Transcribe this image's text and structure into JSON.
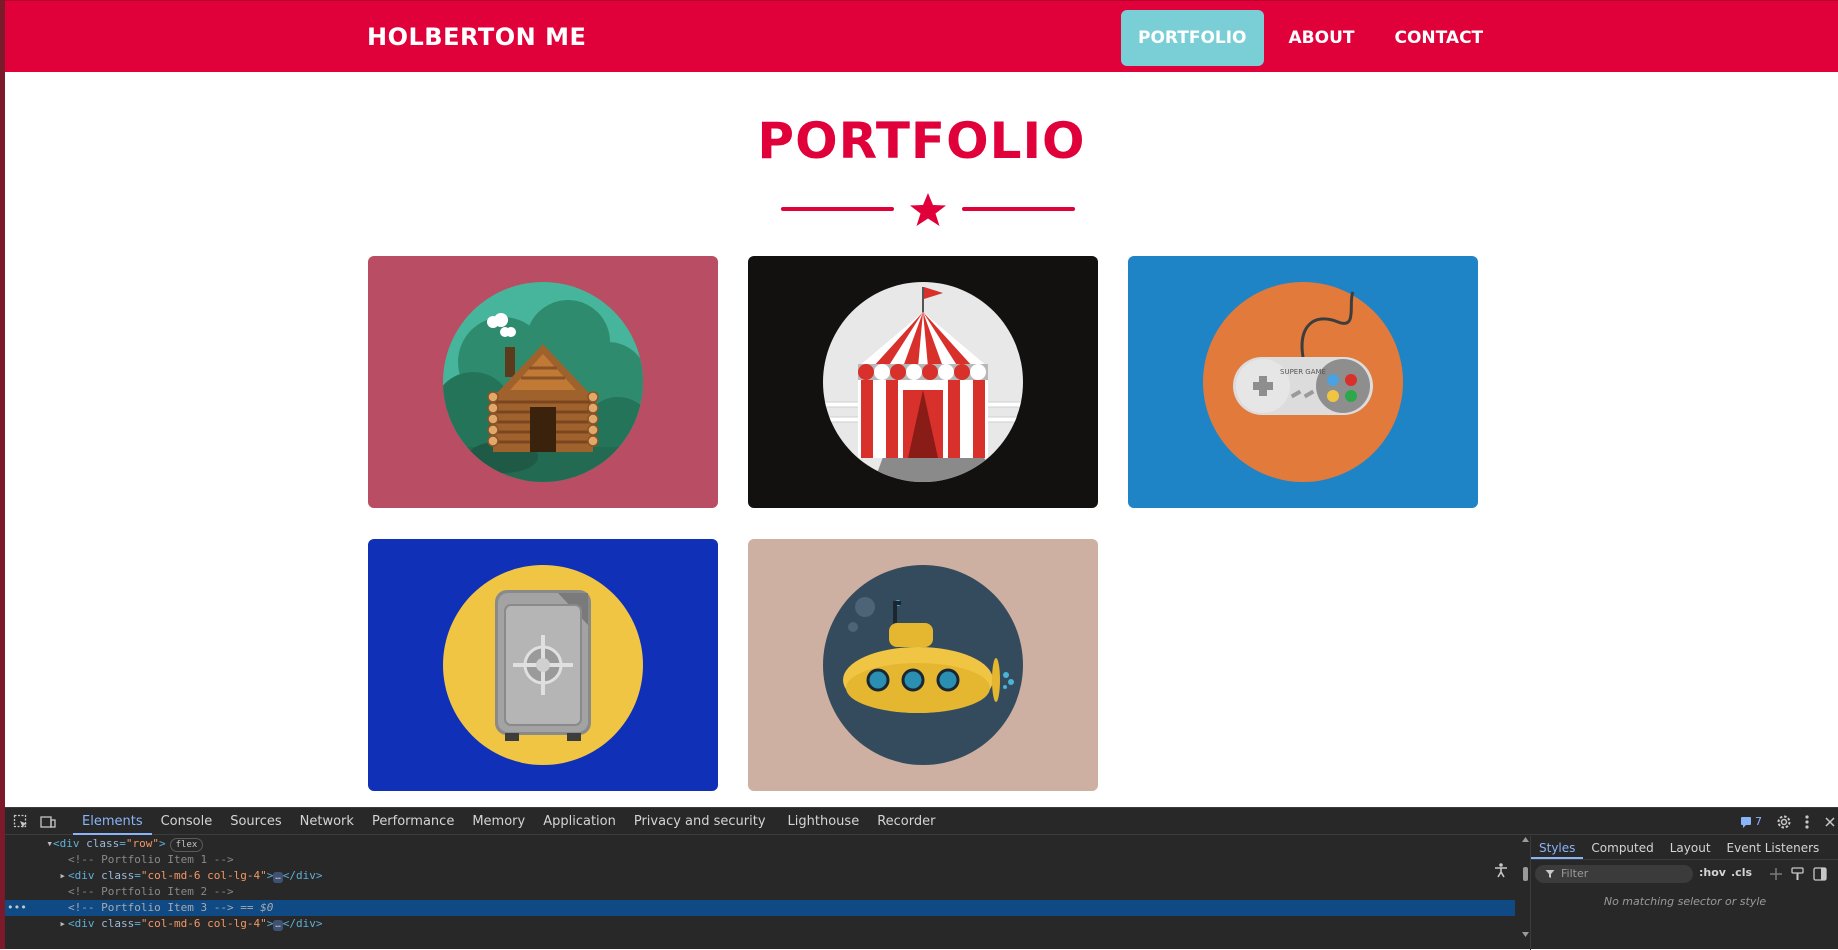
{
  "navbar": {
    "brand": "HOLBERTON ME",
    "items": [
      {
        "label": "PORTFOLIO",
        "active": true
      },
      {
        "label": "ABOUT",
        "active": false
      },
      {
        "label": "CONTACT",
        "active": false
      }
    ]
  },
  "portfolio": {
    "title": "PORTFOLIO",
    "items": [
      {
        "name": "cabin",
        "icon": "log-cabin-icon",
        "bg": "#b94d63",
        "circle": "#46b59b"
      },
      {
        "name": "circus",
        "icon": "circus-tent-icon",
        "bg": "#131010",
        "circle": "#e8e8e8"
      },
      {
        "name": "game",
        "icon": "game-controller-icon",
        "bg": "#1e84c6",
        "circle": "#e27a3c"
      },
      {
        "name": "safe",
        "icon": "safe-icon",
        "bg": "#1031b7",
        "circle": "#f0c544"
      },
      {
        "name": "submarine",
        "icon": "submarine-icon",
        "bg": "#cdb0a2",
        "circle": "#344b5e"
      }
    ]
  },
  "colors": {
    "accent": "#e0003a",
    "active_nav": "#7acfd6"
  },
  "devtools": {
    "tabs": [
      "Elements",
      "Console",
      "Sources",
      "Network",
      "Performance",
      "Memory",
      "Application",
      "Privacy and security",
      "Lighthouse",
      "Recorder"
    ],
    "active_tab": "Elements",
    "issues_count": "7",
    "dom_lines": [
      {
        "tag_open": "<div ",
        "attr": "class",
        "value": "\"row\"",
        "tag_close": ">",
        "pill": "flex"
      },
      {
        "comment": "<!-- Portfolio Item 1 -->"
      },
      {
        "tag_open": "<div ",
        "attr": "class",
        "value": "\"col-md-6 col-lg-4\"",
        "tag_close": ">",
        "ell": "…",
        "end": "</div>"
      },
      {
        "comment": "<!-- Portfolio Item 2 -->"
      },
      {
        "comment": "<!-- Portfolio Item 3 -->",
        "suffix": " == $0"
      },
      {
        "tag_open": "<div ",
        "attr": "class",
        "value": "\"col-md-6 col-lg-4\"",
        "tag_close": ">",
        "ell": "…",
        "end": "</div>"
      }
    ],
    "side_tabs": [
      "Styles",
      "Computed",
      "Layout",
      "Event Listeners"
    ],
    "filter_placeholder": "Filter",
    "hov_label": ":hov",
    "cls_label": ".cls",
    "no_match": "No matching selector or style",
    "row_dots": "•••"
  }
}
